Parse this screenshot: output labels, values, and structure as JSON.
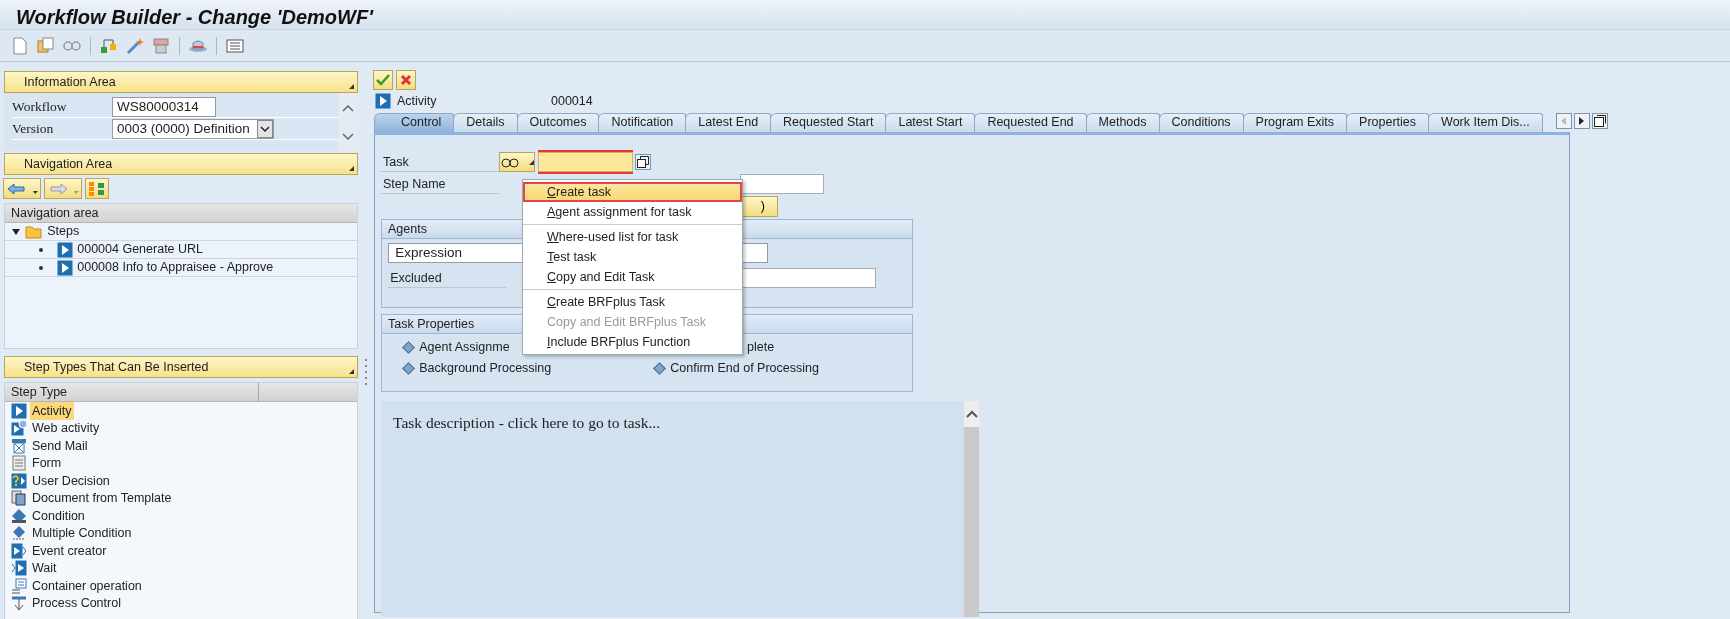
{
  "window": {
    "title": "Workflow Builder - Change 'DemoWF'"
  },
  "information_area": {
    "title": "Information Area",
    "fields": [
      {
        "label": "Workflow",
        "value": "WS80000314",
        "kind": "text"
      },
      {
        "label": "Version",
        "value": "0003 (0000) Definition",
        "kind": "dropdown"
      }
    ]
  },
  "navigation_area": {
    "title": "Navigation Area",
    "column": "Navigation area",
    "tree": [
      {
        "label": "Steps",
        "expanded": true,
        "children": [
          {
            "label": "000004 Generate URL"
          },
          {
            "label": "000008 Info to Appraisee - Approve"
          }
        ]
      }
    ]
  },
  "step_types": {
    "title": "Step Types That Can Be Inserted",
    "column": "Step Type",
    "items": [
      {
        "label": "Activity",
        "selected": true
      },
      {
        "label": "Web activity",
        "selected": false
      },
      {
        "label": "Send Mail",
        "selected": false
      },
      {
        "label": "Form",
        "selected": false
      },
      {
        "label": "User Decision",
        "selected": false
      },
      {
        "label": "Document from Template",
        "selected": false
      },
      {
        "label": "Condition",
        "selected": false
      },
      {
        "label": "Multiple Condition",
        "selected": false
      },
      {
        "label": "Event creator",
        "selected": false
      },
      {
        "label": "Wait",
        "selected": false
      },
      {
        "label": "Container operation",
        "selected": false
      },
      {
        "label": "Process Control",
        "selected": false
      }
    ]
  },
  "step": {
    "type": "Activity",
    "number": "000014"
  },
  "tabs": [
    {
      "label": "Control",
      "selected": true
    },
    {
      "label": "Details",
      "selected": false
    },
    {
      "label": "Outcomes",
      "selected": false
    },
    {
      "label": "Notification",
      "selected": false
    },
    {
      "label": "Latest End",
      "selected": false
    },
    {
      "label": "Requested Start",
      "selected": false
    },
    {
      "label": "Latest Start",
      "selected": false
    },
    {
      "label": "Requested End",
      "selected": false
    },
    {
      "label": "Methods",
      "selected": false
    },
    {
      "label": "Conditions",
      "selected": false
    },
    {
      "label": "Program Exits",
      "selected": false
    },
    {
      "label": "Properties",
      "selected": false
    },
    {
      "label": "Work Item Dis...",
      "selected": false
    }
  ],
  "control": {
    "task_label": "Task",
    "step_name_label": "Step Name",
    "button_fragment": ")"
  },
  "agents": {
    "title": "Agents",
    "rows": [
      {
        "label": "Expression",
        "kind": "field"
      },
      {
        "label": "Excluded",
        "kind": "label"
      }
    ]
  },
  "task_properties": {
    "title": "Task Properties",
    "left": [
      "Agent Assignme",
      "Background Processing"
    ],
    "right": [
      "plete",
      "Confirm End of Processing"
    ]
  },
  "task_description": "Task description - click here to go to task...",
  "context_menu": {
    "groups": [
      [
        {
          "label": "Create task",
          "selected": true,
          "disabled": false
        },
        {
          "label": "Agent assignment for task",
          "selected": false,
          "disabled": false
        }
      ],
      [
        {
          "label": "Where-used list for task",
          "selected": false,
          "disabled": false
        },
        {
          "label": "Test task",
          "selected": false,
          "disabled": false
        },
        {
          "label": "Copy and Edit Task",
          "selected": false,
          "disabled": false
        }
      ],
      [
        {
          "label": "Create BRFplus Task",
          "selected": false,
          "disabled": false
        },
        {
          "label": "Copy and Edit BRFplus Task",
          "selected": false,
          "disabled": true
        },
        {
          "label": "Include BRFplus Function",
          "selected": false,
          "disabled": false
        }
      ]
    ]
  }
}
